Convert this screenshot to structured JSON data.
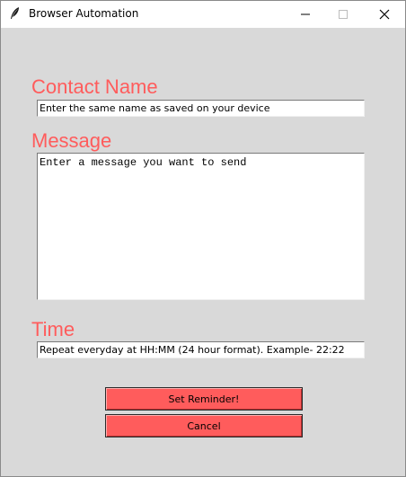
{
  "window": {
    "title": "Browser Automation",
    "app_icon": "feather-icon",
    "controls": {
      "minimize_icon": "minimize-icon",
      "maximize_icon": "maximize-icon",
      "close_icon": "close-icon"
    }
  },
  "form": {
    "contact": {
      "label": "Contact Name",
      "value": "Enter the same name as saved on your device"
    },
    "message": {
      "label": "Message",
      "value": "Enter a message you want to send"
    },
    "time": {
      "label": "Time",
      "value": "Repeat everyday at HH:MM (24 hour format). Example- 22:22"
    }
  },
  "buttons": {
    "set_reminder": "Set Reminder!",
    "cancel": "Cancel"
  },
  "colors": {
    "accent": "#ff5c5c",
    "background": "#d9d9d9",
    "titlebar": "#ffffff"
  }
}
